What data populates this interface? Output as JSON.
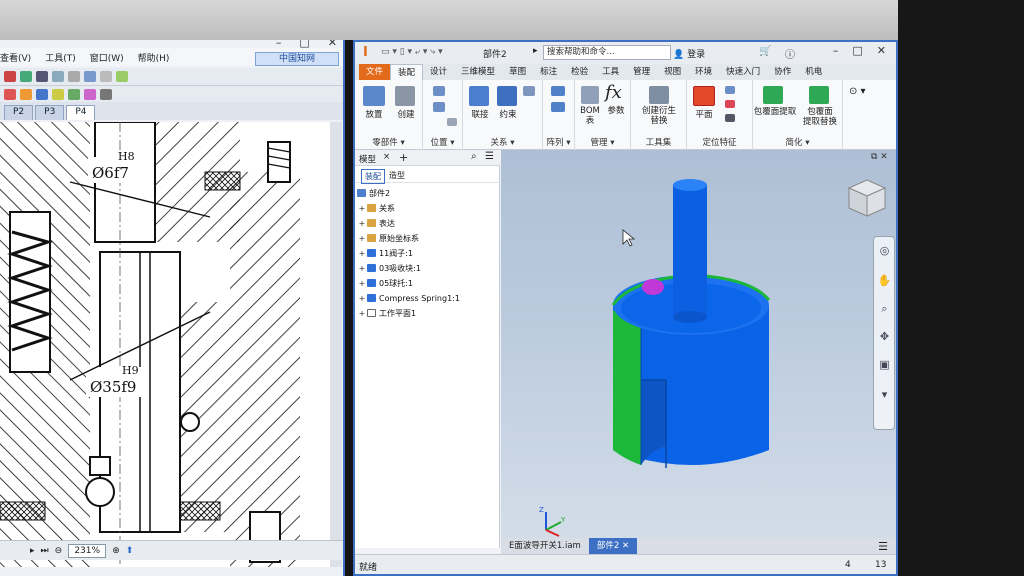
{
  "left_window": {
    "menu": [
      "查看(V)",
      "工具(T)",
      "窗口(W)",
      "帮助(H)"
    ],
    "cnki_label": "中国知网",
    "tabs": [
      "P2",
      "P3",
      "P4"
    ],
    "zoom": "231%",
    "dimensions": {
      "d1_fit": "H8",
      "d1_value": "Ø6f7",
      "d2_fit": "H9",
      "d2_value": "Ø35f9"
    }
  },
  "right_window": {
    "app_logo": "I",
    "doc_title": "部件2",
    "search_placeholder": "搜索帮助和命令...",
    "login": "登录",
    "ribbon_tabs": [
      "文件",
      "装配",
      "设计",
      "三维模型",
      "草图",
      "标注",
      "检验",
      "工具",
      "管理",
      "视图",
      "环境",
      "快速入门",
      "协作",
      "机电"
    ],
    "active_ribbon_tab": "装配",
    "ribbon": {
      "place": "放置",
      "create": "创建",
      "group_component": "零部件 ▾",
      "group_position": "位置 ▾",
      "join": "联接",
      "constrain": "约束",
      "group_relations": "关系 ▾",
      "group_pattern": "阵列 ▾",
      "bom": "BOM\n表",
      "params": "参数",
      "group_manage": "管理 ▾",
      "create_derived": "创建衍生\n替换",
      "group_productivity": "工具集",
      "plane": "平面",
      "group_work": "定位特征",
      "shrinkwrap": "包覆面提取",
      "shrinkwrap_sub": "包覆面\n提取替换",
      "group_simplify": "简化 ▾"
    },
    "browser": {
      "tab_model": "模型",
      "close": "×",
      "add": "+",
      "sub_assembly": "装配",
      "sub_modeling": "造型",
      "root": "部件2",
      "items": [
        "关系",
        "表达",
        "原始坐标系",
        "11阀子:1",
        "03吸收块:1",
        "05球托:1",
        "Compress Spring1:1",
        "工作平面1"
      ]
    },
    "doc_tabs": [
      "E面波导开关1.iam",
      "部件2"
    ],
    "active_doc_tab": "部件2",
    "status": {
      "text": "就绪",
      "count1": "4",
      "count2": "13"
    },
    "colors": {
      "accent": "#3d6fc4",
      "file_tab": "#e36a1b",
      "part_blue": "#0a62e6",
      "part_green": "#1cb83a",
      "ball": "#c038d8"
    }
  }
}
